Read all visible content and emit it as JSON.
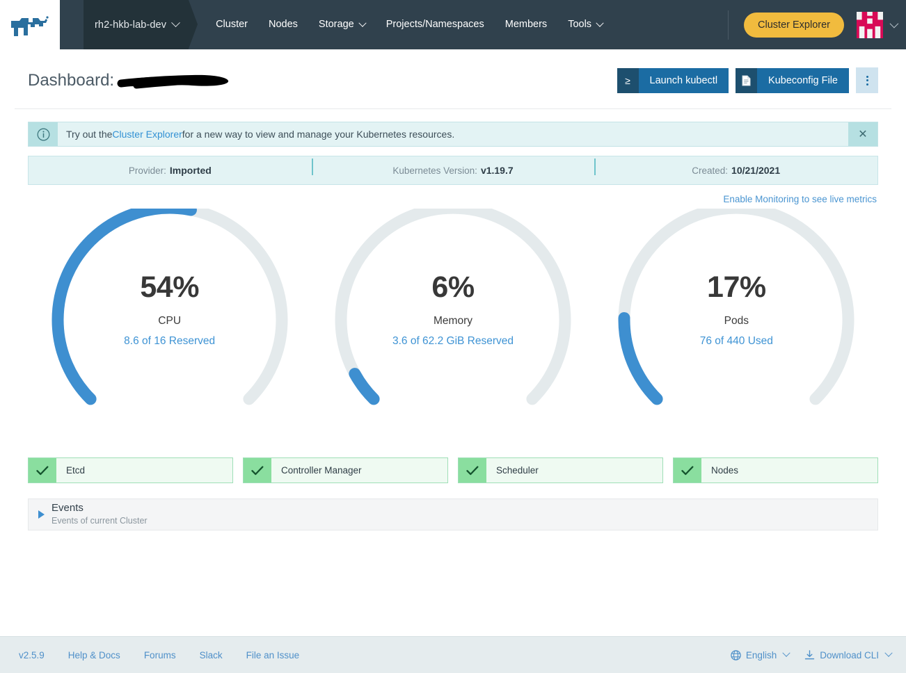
{
  "topnav": {
    "logo_icon": "rancher-bull-logo",
    "cluster_selector": {
      "name": "rh2-hkb-lab-dev",
      "chevron_icon": "chevron-down-icon"
    },
    "links": [
      {
        "label": "Cluster",
        "has_chevron": false
      },
      {
        "label": "Nodes",
        "has_chevron": false
      },
      {
        "label": "Storage",
        "has_chevron": true
      },
      {
        "label": "Projects/Namespaces",
        "has_chevron": false
      },
      {
        "label": "Members",
        "has_chevron": false
      },
      {
        "label": "Tools",
        "has_chevron": true
      }
    ],
    "explorer_button": "Cluster Explorer",
    "avatar_icon": "user-avatar-identicon",
    "avatar_chevron_icon": "chevron-down-icon",
    "accent_yellow": "#f1bb3e",
    "nav_bg": "#30414d",
    "cluster_pill_bg": "#233239"
  },
  "header": {
    "title_prefix": "Dashboard:",
    "title_redacted": true,
    "actions": {
      "launch_kubectl": {
        "label": "Launch kubectl",
        "icon": "terminal-prompt-icon"
      },
      "kubeconfig": {
        "label": "Kubeconfig File",
        "icon": "file-document-icon"
      },
      "kebab": {
        "icon": "kebab-menu-icon"
      }
    }
  },
  "banner": {
    "icon": "info-circle-icon",
    "text_before": "Try out the ",
    "link": "Cluster Explorer",
    "text_after": " for a new way to view and manage your Kubernetes resources.",
    "close_icon": "close-icon"
  },
  "infobar": [
    {
      "key": "Provider:",
      "value": "Imported"
    },
    {
      "key": "Kubernetes Version:",
      "value": "v1.19.7"
    },
    {
      "key": "Created:",
      "value": "10/21/2021"
    }
  ],
  "monitoring_link": "Enable Monitoring to see live metrics",
  "chart_data": {
    "type": "gauge",
    "title": "Cluster resource reservation gauges",
    "arc_start_deg": 225,
    "arc_sweep_deg": 270,
    "track_color": "#e4eaec",
    "fill_color": "#3e8fd0",
    "gauges": [
      {
        "name": "CPU",
        "percent": 54,
        "value": 8.6,
        "max": 16,
        "unit": "",
        "percent_label": "54%",
        "label": "CPU",
        "sublabel": "8.6 of 16 Reserved"
      },
      {
        "name": "Memory",
        "percent": 6,
        "value": 3.6,
        "max": 62.2,
        "unit": "GiB",
        "percent_label": "6%",
        "label": "Memory",
        "sublabel": "3.6 of 62.2 GiB Reserved"
      },
      {
        "name": "Pods",
        "percent": 17,
        "value": 76,
        "max": 440,
        "unit": "",
        "percent_label": "17%",
        "label": "Pods",
        "sublabel": "76 of 440 Used"
      }
    ]
  },
  "components": [
    {
      "label": "Etcd",
      "status": "healthy",
      "icon": "check-icon"
    },
    {
      "label": "Controller Manager",
      "status": "healthy",
      "icon": "check-icon"
    },
    {
      "label": "Scheduler",
      "status": "healthy",
      "icon": "check-icon"
    },
    {
      "label": "Nodes",
      "status": "healthy",
      "icon": "check-icon"
    }
  ],
  "events": {
    "expander_icon": "triangle-right-icon",
    "title": "Events",
    "subtitle": "Events of current Cluster",
    "expanded": false
  },
  "footer": {
    "links": [
      {
        "label": "v2.5.9"
      },
      {
        "label": "Help & Docs"
      },
      {
        "label": "Forums"
      },
      {
        "label": "Slack"
      },
      {
        "label": "File an Issue"
      }
    ],
    "language": {
      "label": "English",
      "icon": "globe-icon",
      "chevron_icon": "chevron-down-icon"
    },
    "download": {
      "label": "Download CLI",
      "icon": "download-icon",
      "chevron_icon": "chevron-down-icon"
    }
  }
}
